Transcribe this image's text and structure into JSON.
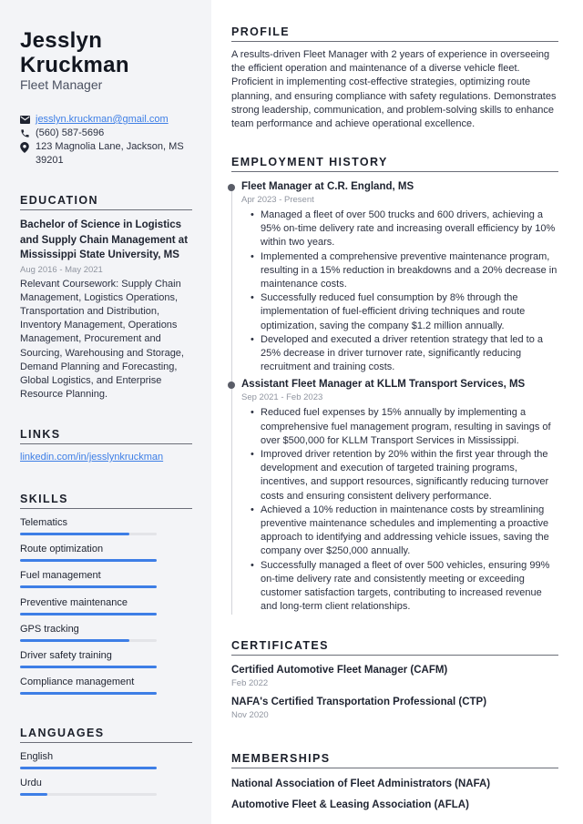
{
  "header": {
    "first_name": "Jesslyn",
    "last_name": "Kruckman",
    "job_title": "Fleet Manager"
  },
  "contact": {
    "email": "jesslyn.kruckman@gmail.com",
    "phone": "(560) 587-5696",
    "address": "123 Magnolia Lane, Jackson, MS 39201",
    "icons": [
      "envelope-icon",
      "phone-icon",
      "location-pin-icon"
    ]
  },
  "education": {
    "title": "EDUCATION",
    "degree": "Bachelor of Science in Logistics and Supply Chain Management at Mississippi State University, MS",
    "date": "Aug 2016 - May 2021",
    "description": "Relevant Coursework: Supply Chain Management, Logistics Operations, Transportation and Distribution, Inventory Management, Operations Management, Procurement and Sourcing, Warehousing and Storage, Demand Planning and Forecasting, Global Logistics, and Enterprise Resource Planning."
  },
  "links": {
    "title": "LINKS",
    "items": [
      "linkedin.com/in/jesslynkruckman"
    ]
  },
  "skills": {
    "title": "SKILLS",
    "items": [
      {
        "label": "Telematics",
        "level": 0.8
      },
      {
        "label": "Route optimization",
        "level": 1.0
      },
      {
        "label": "Fuel management",
        "level": 1.0
      },
      {
        "label": "Preventive maintenance",
        "level": 1.0
      },
      {
        "label": "GPS tracking",
        "level": 0.8
      },
      {
        "label": "Driver safety training",
        "level": 1.0
      },
      {
        "label": "Compliance management",
        "level": 1.0
      }
    ]
  },
  "languages": {
    "title": "LANGUAGES",
    "items": [
      {
        "label": "English",
        "level": 1.0
      },
      {
        "label": "Urdu",
        "level": 0.2
      }
    ]
  },
  "colors": {
    "accent": "#3d7ee6",
    "sidebar_bg": "#f3f4f7",
    "track": "#e3e4e8"
  },
  "profile": {
    "title": "PROFILE",
    "text": "A results-driven Fleet Manager with 2 years of experience in overseeing the efficient operation and maintenance of a diverse vehicle fleet. Proficient in implementing cost-effective strategies, optimizing route planning, and ensuring compliance with safety regulations. Demonstrates strong leadership, communication, and problem-solving skills to enhance team performance and achieve operational excellence."
  },
  "employment": {
    "title": "EMPLOYMENT HISTORY",
    "jobs": [
      {
        "title": "Fleet Manager at C.R. England, MS",
        "date": "Apr 2023 - Present",
        "bullets": [
          "Managed a fleet of over 500 trucks and 600 drivers, achieving a 95% on-time delivery rate and increasing overall efficiency by 10% within two years.",
          "Implemented a comprehensive preventive maintenance program, resulting in a 15% reduction in breakdowns and a 20% decrease in maintenance costs.",
          "Successfully reduced fuel consumption by 8% through the implementation of fuel-efficient driving techniques and route optimization, saving the company $1.2 million annually.",
          "Developed and executed a driver retention strategy that led to a 25% decrease in driver turnover rate, significantly reducing recruitment and training costs."
        ]
      },
      {
        "title": "Assistant Fleet Manager at KLLM Transport Services, MS",
        "date": "Sep 2021 - Feb 2023",
        "bullets": [
          "Reduced fuel expenses by 15% annually by implementing a comprehensive fuel management program, resulting in savings of over $500,000 for KLLM Transport Services in Mississippi.",
          "Improved driver retention by 20% within the first year through the development and execution of targeted training programs, incentives, and support resources, significantly reducing turnover costs and ensuring consistent delivery performance.",
          "Achieved a 10% reduction in maintenance costs by streamlining preventive maintenance schedules and implementing a proactive approach to identifying and addressing vehicle issues, saving the company over $250,000 annually.",
          "Successfully managed a fleet of over 500 vehicles, ensuring 99% on-time delivery rate and consistently meeting or exceeding customer satisfaction targets, contributing to increased revenue and long-term client relationships."
        ]
      }
    ]
  },
  "certificates": {
    "title": "CERTIFICATES",
    "items": [
      {
        "name": "Certified Automotive Fleet Manager (CAFM)",
        "date": "Feb 2022"
      },
      {
        "name": "NAFA's Certified Transportation Professional (CTP)",
        "date": "Nov 2020"
      }
    ]
  },
  "memberships": {
    "title": "MEMBERSHIPS",
    "items": [
      "National Association of Fleet Administrators (NAFA)",
      "Automotive Fleet & Leasing Association (AFLA)"
    ]
  }
}
